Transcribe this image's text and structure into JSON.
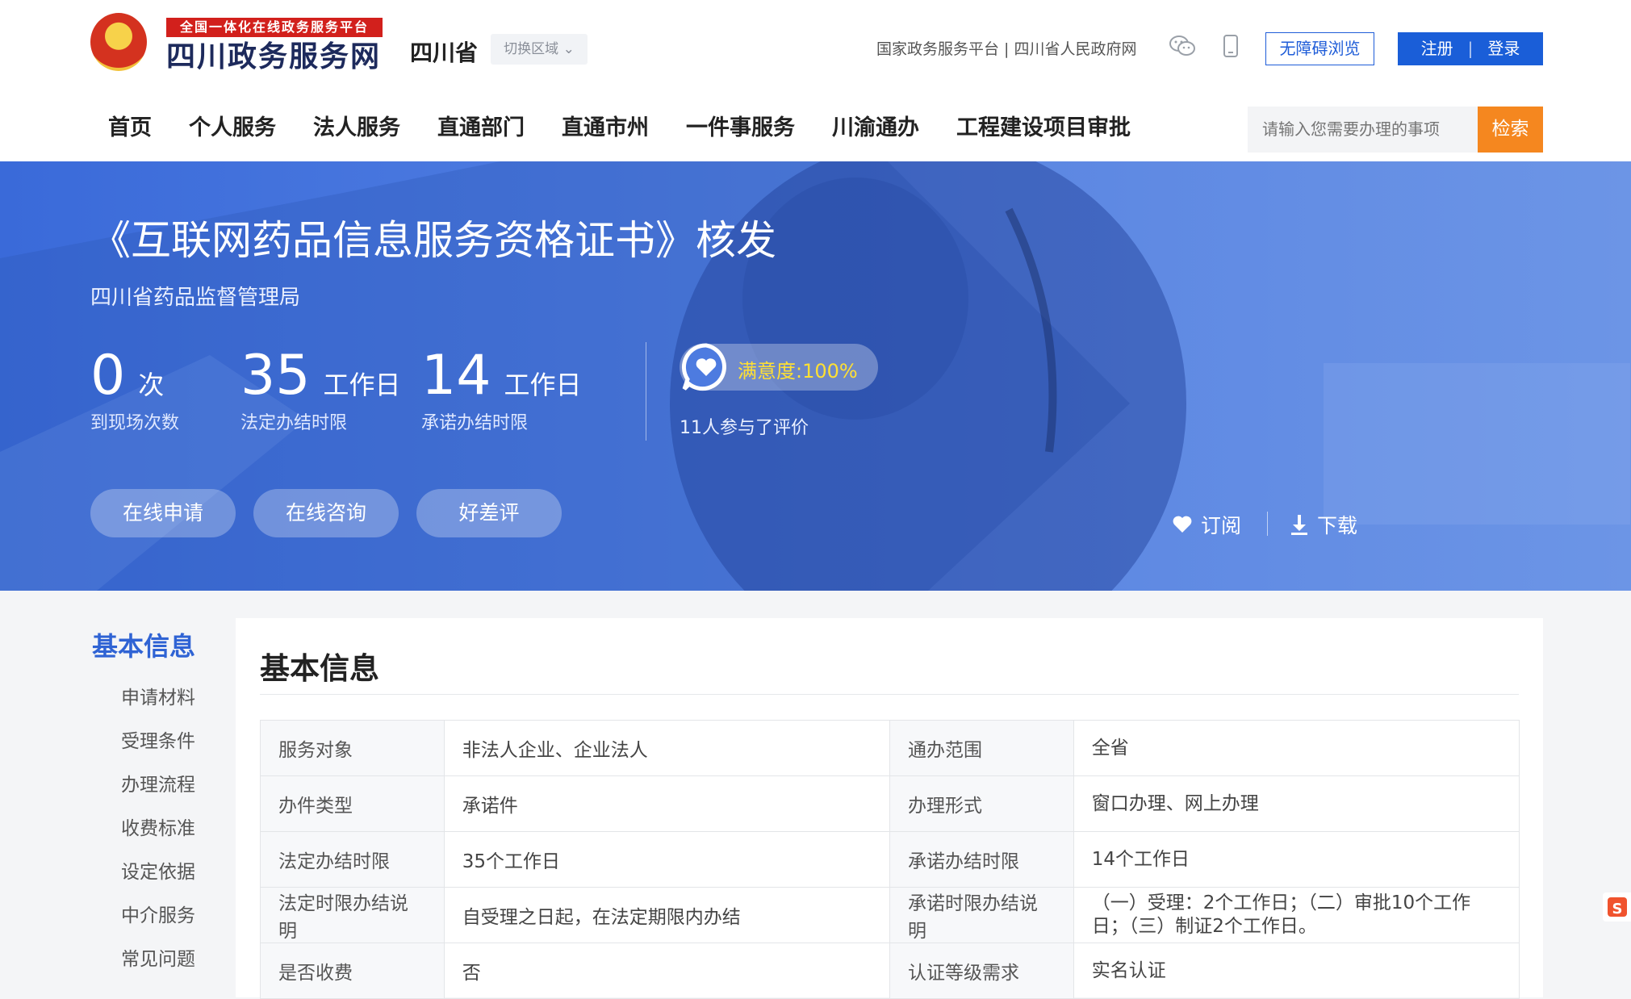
{
  "header": {
    "logo_tag": "全国一体化在线政务服务平台",
    "logo_name": "四川政务服务网",
    "region_name": "四川省",
    "region_switch": "切换区域 ⌄",
    "gov_links": "国家政务服务平台 | 四川省人民政府网",
    "accessibility_label": "无障碍浏览",
    "register_label": "注册",
    "login_label": "登录",
    "search_placeholder": "请输入您需要办理的事项",
    "search_button": "检索"
  },
  "nav": {
    "items": [
      "首页",
      "个人服务",
      "法人服务",
      "直通部门",
      "直通市州",
      "一件事服务",
      "川渝通办",
      "工程建设项目审批"
    ]
  },
  "banner": {
    "title": "《互联网药品信息服务资格证书》核发",
    "department": "四川省药品监督管理局",
    "stats": [
      {
        "num": "0",
        "unit": "次",
        "label": "到现场次数"
      },
      {
        "num": "35",
        "unit": "工作日",
        "label": "法定办结时限"
      },
      {
        "num": "14",
        "unit": "工作日",
        "label": "承诺办结时限"
      }
    ],
    "satisfaction": "满意度:100%",
    "rating_count": "11人参与了评价",
    "buttons": [
      "在线申请",
      "在线咨询",
      "好差评"
    ],
    "subscribe_label": "订阅",
    "download_label": "下载"
  },
  "sidebar": {
    "title": "基本信息",
    "items": [
      "申请材料",
      "受理条件",
      "办理流程",
      "收费标准",
      "设定依据",
      "中介服务",
      "常见问题"
    ]
  },
  "panel": {
    "title": "基本信息",
    "rows": [
      {
        "k1": "服务对象",
        "v1": "非法人企业、企业法人",
        "k2": "通办范围",
        "v2": "全省"
      },
      {
        "k1": "办件类型",
        "v1": "承诺件",
        "k2": "办理形式",
        "v2": "窗口办理、网上办理"
      },
      {
        "k1": "法定办结时限",
        "v1": "35个工作日",
        "k2": "承诺办结时限",
        "v2": "14个工作日"
      },
      {
        "k1": "法定时限办结说明",
        "v1": "自受理之日起，在法定期限内办结",
        "k2": "承诺时限办结说明",
        "v2": "（一）受理：2个工作日；（二）审批10个工作日；（三）制证2个工作日。"
      },
      {
        "k1": "是否收费",
        "v1": "否",
        "k2": "认证等级需求",
        "v2": "实名认证"
      }
    ]
  },
  "colors": {
    "brand_blue": "#1a5ed8",
    "search_orange": "#f5871f",
    "banner_blue": "#4d7be0",
    "satisfaction_yellow": "#ffe033"
  }
}
